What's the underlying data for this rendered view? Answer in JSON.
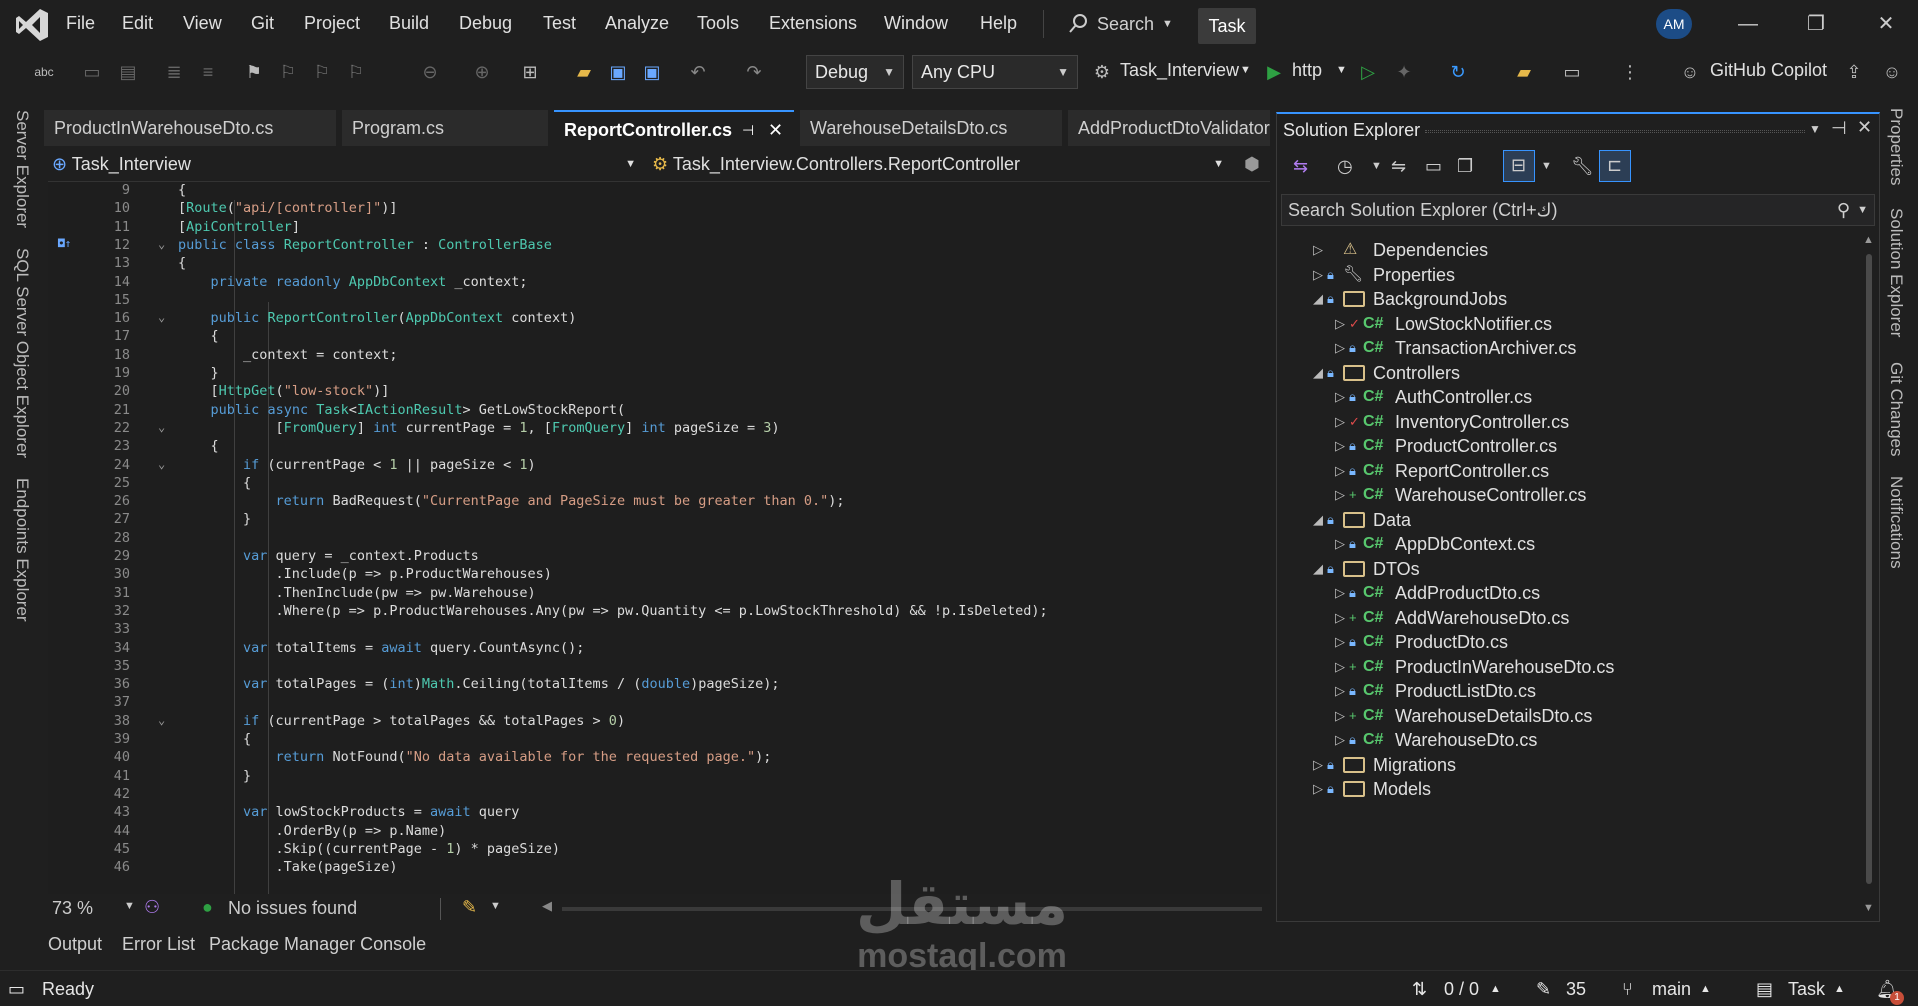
{
  "menu": [
    "File",
    "Edit",
    "View",
    "Git",
    "Project",
    "Build",
    "Debug",
    "Test",
    "Analyze",
    "Tools",
    "Extensions",
    "Window",
    "Help"
  ],
  "search_label": "Search",
  "task_badge": "Task",
  "avatar_initials": "AM",
  "toolbar": {
    "config": "Debug",
    "platform": "Any CPU",
    "startup_project": "Task_Interview",
    "run_profile": "http",
    "copilot": "GitHub Copilot"
  },
  "left_tabs": [
    "Server Explorer",
    "SQL Server Object Explorer",
    "Endpoints Explorer"
  ],
  "right_tabs": [
    "Properties",
    "Solution Explorer",
    "Git Changes",
    "Notifications"
  ],
  "doc_tabs": [
    "ProductInWarehouseDto.cs",
    "Program.cs",
    "ReportController.cs",
    "WarehouseDetailsDto.cs",
    "AddProductDtoValidator.cs"
  ],
  "nav": {
    "project": "Task_Interview",
    "member": "Task_Interview.Controllers.ReportController"
  },
  "code_lines": [
    {
      "n": "9",
      "t": "{"
    },
    {
      "n": "10",
      "t": "[Route(\"api/[controller]\")]"
    },
    {
      "n": "11",
      "t": "[ApiController]"
    },
    {
      "n": "12",
      "t": "public class ReportController : ControllerBase"
    },
    {
      "n": "13",
      "t": "{"
    },
    {
      "n": "14",
      "t": "    private readonly AppDbContext _context;"
    },
    {
      "n": "15",
      "t": ""
    },
    {
      "n": "16",
      "t": "    public ReportController(AppDbContext context)"
    },
    {
      "n": "17",
      "t": "    {"
    },
    {
      "n": "18",
      "t": "        _context = context;"
    },
    {
      "n": "19",
      "t": "    }"
    },
    {
      "n": "20",
      "t": "    [HttpGet(\"low-stock\")]"
    },
    {
      "n": "21",
      "t": "    public async Task<IActionResult> GetLowStockReport("
    },
    {
      "n": "22",
      "t": "            [FromQuery] int currentPage = 1, [FromQuery] int pageSize = 3)"
    },
    {
      "n": "23",
      "t": "    {"
    },
    {
      "n": "24",
      "t": "        if (currentPage < 1 || pageSize < 1)"
    },
    {
      "n": "25",
      "t": "        {"
    },
    {
      "n": "26",
      "t": "            return BadRequest(\"CurrentPage and PageSize must be greater than 0.\");"
    },
    {
      "n": "27",
      "t": "        }"
    },
    {
      "n": "28",
      "t": ""
    },
    {
      "n": "29",
      "t": "        var query = _context.Products"
    },
    {
      "n": "30",
      "t": "            .Include(p => p.ProductWarehouses)"
    },
    {
      "n": "31",
      "t": "            .ThenInclude(pw => pw.Warehouse)"
    },
    {
      "n": "32",
      "t": "            .Where(p => p.ProductWarehouses.Any(pw => pw.Quantity <= p.LowStockThreshold) && !p.IsDeleted);"
    },
    {
      "n": "33",
      "t": ""
    },
    {
      "n": "34",
      "t": "        var totalItems = await query.CountAsync();"
    },
    {
      "n": "35",
      "t": ""
    },
    {
      "n": "36",
      "t": "        var totalPages = (int)Math.Ceiling(totalItems / (double)pageSize);"
    },
    {
      "n": "37",
      "t": ""
    },
    {
      "n": "38",
      "t": "        if (currentPage > totalPages && totalPages > 0)"
    },
    {
      "n": "39",
      "t": "        {"
    },
    {
      "n": "40",
      "t": "            return NotFound(\"No data available for the requested page.\");"
    },
    {
      "n": "41",
      "t": "        }"
    },
    {
      "n": "42",
      "t": ""
    },
    {
      "n": "43",
      "t": "        var lowStockProducts = await query"
    },
    {
      "n": "44",
      "t": "            .OrderBy(p => p.Name)"
    },
    {
      "n": "45",
      "t": "            .Skip((currentPage - 1) * pageSize)"
    },
    {
      "n": "46",
      "t": "            .Take(pageSize)"
    }
  ],
  "editor_status": {
    "zoom": "73 %",
    "issues": "No issues found"
  },
  "solution_explorer": {
    "title": "Solution Explorer",
    "search_placeholder": "Search Solution Explorer (Ctrl+ك)",
    "tree": [
      {
        "label": "Dependencies",
        "kind": "deps",
        "depth": 1,
        "expanded": false
      },
      {
        "label": "Properties",
        "kind": "props",
        "depth": 1,
        "expanded": false
      },
      {
        "label": "BackgroundJobs",
        "kind": "folder",
        "depth": 1,
        "expanded": true
      },
      {
        "label": "LowStockNotifier.cs",
        "kind": "cs",
        "depth": 2,
        "mark": "check"
      },
      {
        "label": "TransactionArchiver.cs",
        "kind": "cs",
        "depth": 2,
        "mark": "lock"
      },
      {
        "label": "Controllers",
        "kind": "folder",
        "depth": 1,
        "expanded": true
      },
      {
        "label": "AuthController.cs",
        "kind": "cs",
        "depth": 2,
        "mark": "lock"
      },
      {
        "label": "InventoryController.cs",
        "kind": "cs",
        "depth": 2,
        "mark": "check"
      },
      {
        "label": "ProductController.cs",
        "kind": "cs",
        "depth": 2,
        "mark": "lock"
      },
      {
        "label": "ReportController.cs",
        "kind": "cs",
        "depth": 2,
        "mark": "lock"
      },
      {
        "label": "WarehouseController.cs",
        "kind": "cs",
        "depth": 2,
        "mark": "plus"
      },
      {
        "label": "Data",
        "kind": "folder",
        "depth": 1,
        "expanded": true
      },
      {
        "label": "AppDbContext.cs",
        "kind": "cs",
        "depth": 2,
        "mark": "lock"
      },
      {
        "label": "DTOs",
        "kind": "folder",
        "depth": 1,
        "expanded": true
      },
      {
        "label": "AddProductDto.cs",
        "kind": "cs",
        "depth": 2,
        "mark": "lock"
      },
      {
        "label": "AddWarehouseDto.cs",
        "kind": "cs",
        "depth": 2,
        "mark": "plus"
      },
      {
        "label": "ProductDto.cs",
        "kind": "cs",
        "depth": 2,
        "mark": "lock"
      },
      {
        "label": "ProductInWarehouseDto.cs",
        "kind": "cs",
        "depth": 2,
        "mark": "plus"
      },
      {
        "label": "ProductListDto.cs",
        "kind": "cs",
        "depth": 2,
        "mark": "lock"
      },
      {
        "label": "WarehouseDetailsDto.cs",
        "kind": "cs",
        "depth": 2,
        "mark": "plus"
      },
      {
        "label": "WarehouseDto.cs",
        "kind": "cs",
        "depth": 2,
        "mark": "lock"
      },
      {
        "label": "Migrations",
        "kind": "folder",
        "depth": 1,
        "expanded": false
      },
      {
        "label": "Models",
        "kind": "folder",
        "depth": 1,
        "expanded": false
      }
    ]
  },
  "bottom_tabs": [
    "Output",
    "Error List",
    "Package Manager Console"
  ],
  "status_bar": {
    "ready": "Ready",
    "sync": "0 / 0",
    "edits": "35",
    "branch": "main",
    "task": "Task",
    "notif_count": "1"
  },
  "watermark": {
    "arabic": "مستقل",
    "latin": "mostaql.com"
  },
  "colors": {
    "accent": "#3794ff",
    "background": "#1f1f1f",
    "editor": "#1e1e1e",
    "keyword": "#569cd6",
    "type": "#4ec9b0",
    "string": "#d69d85"
  }
}
